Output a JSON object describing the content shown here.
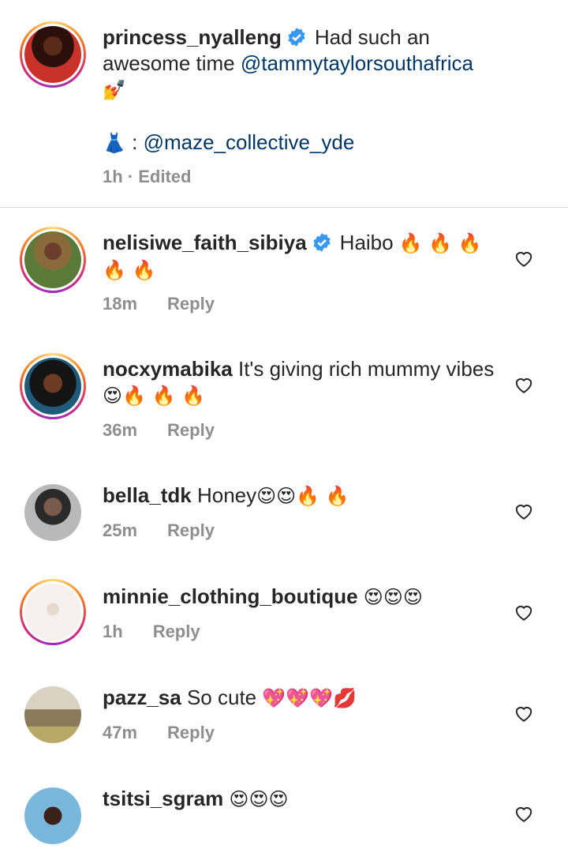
{
  "post": {
    "username": "princess_nyalleng",
    "text": "Had such an awesome time",
    "mention": "@tammytaylorsouthafrica",
    "emoji_line": "💅",
    "dress_emoji": "👗",
    "dress_prefix": " : ",
    "dress_mention": "@maze_collective_yde",
    "time": "1h",
    "separator": " · ",
    "edited": "Edited"
  },
  "comments": [
    {
      "username": "nelisiwe_faith_sibiya",
      "text": "Haibo",
      "emojis": "🔥 🔥 🔥 🔥 🔥",
      "time": "18m",
      "reply": "Reply"
    },
    {
      "username": "nocxymabika",
      "text": "It's giving rich mummy vibes",
      "emojis": "😍🔥 🔥 🔥",
      "time": "36m",
      "reply": "Reply"
    },
    {
      "username": "bella_tdk",
      "text": "Honey",
      "emojis": "😍😍🔥 🔥",
      "time": "25m",
      "reply": "Reply"
    },
    {
      "username": "minnie_clothing_boutique",
      "text": "",
      "emojis": "😍😍😍",
      "time": "1h",
      "reply": "Reply"
    },
    {
      "username": "pazz_sa",
      "text": "So cute",
      "emojis": "💖💖💖💋",
      "time": "47m",
      "reply": "Reply"
    },
    {
      "username": "tsitsi_sgram",
      "text": "",
      "emojis": "😍😍😍",
      "time": "",
      "reply": ""
    }
  ],
  "colors": {
    "link": "#00376b",
    "verified": "#3897f0",
    "meta": "#8e8e8e",
    "text": "#262626"
  },
  "icons": [
    "verified-badge-icon",
    "heart-outline-icon"
  ]
}
